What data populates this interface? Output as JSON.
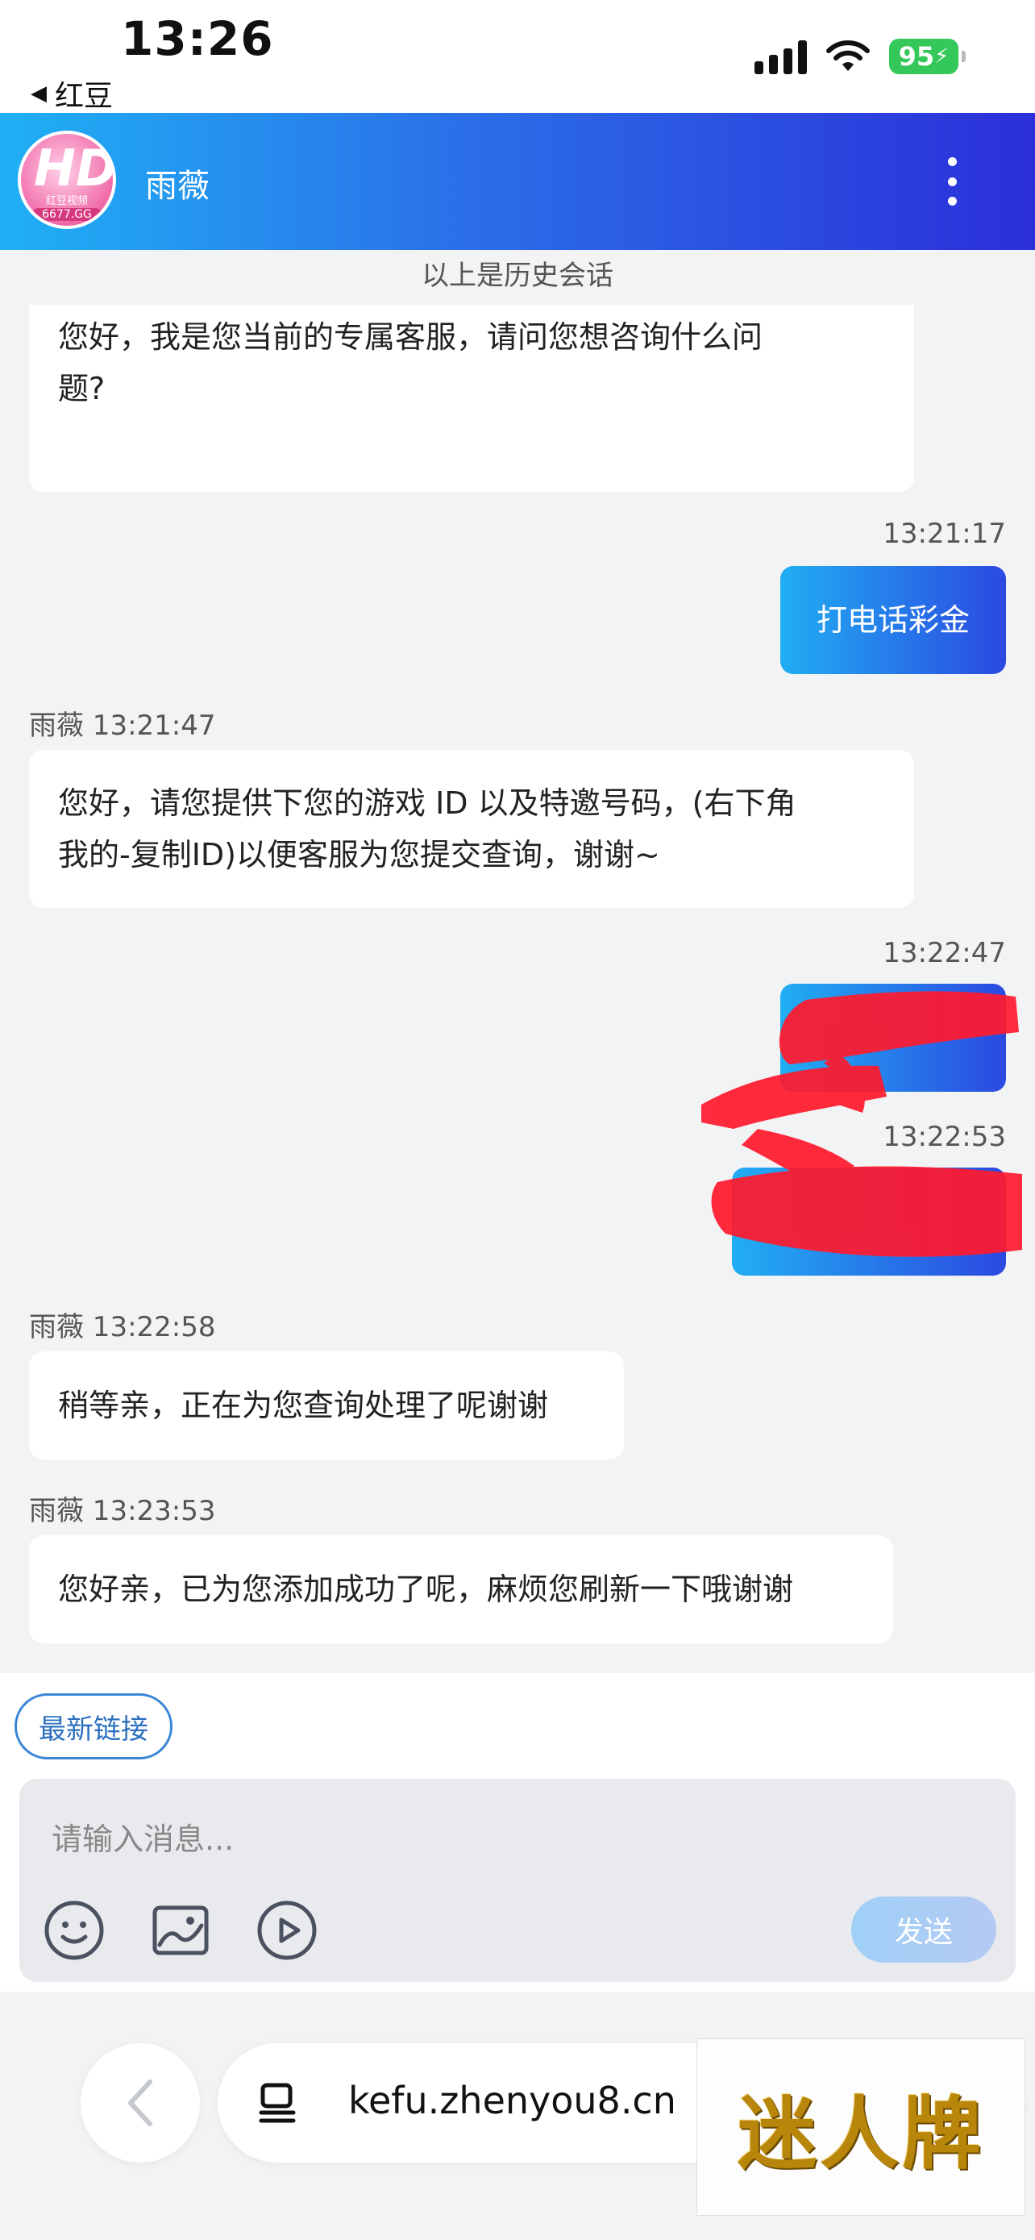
{
  "status_bar": {
    "time": "13:26",
    "back_app": "红豆",
    "battery": "95"
  },
  "header": {
    "title": "雨薇",
    "avatar_text": "HD",
    "avatar_caption": "红豆视频",
    "avatar_domain": "6677.GG"
  },
  "chat": {
    "history_note": "以上是历史会话",
    "messages": [
      {
        "side": "agent",
        "meta": "",
        "text_line1": "您好，我是您当前的专属客服，请问您想咨询什么问",
        "text_line2": "题?"
      },
      {
        "side": "user",
        "meta": "13:21:17",
        "text": "打电话彩金"
      },
      {
        "side": "agent",
        "meta": "雨薇 13:21:47",
        "text_line1": "您好，请您提供下您的游戏 ID 以及特邀号码，(右下角",
        "text_line2": "我的-复制ID)以便客服为您提交查询，谢谢~"
      },
      {
        "side": "user",
        "meta": "13:22:47",
        "text": ""
      },
      {
        "side": "user",
        "meta": "13:22:53",
        "text": ""
      },
      {
        "side": "agent",
        "meta": "雨薇 13:22:58",
        "text": "稍等亲，正在为您查询处理了呢谢谢"
      },
      {
        "side": "agent",
        "meta": "雨薇 13:23:53",
        "text": "您好亲，已为您添加成功了呢，麻烦您刷新一下哦谢谢"
      }
    ]
  },
  "latest_link": "最新链接",
  "composer": {
    "placeholder": "请输入消息...",
    "send_label": "发送",
    "tools": [
      "emoji-icon",
      "image-icon",
      "video-icon"
    ]
  },
  "browser": {
    "url": "kefu.zhenyou8.cn"
  },
  "watermark": "迷人牌",
  "colors": {
    "header_gradient_start": "#1fb0f5",
    "header_gradient_end": "#2b2fd9",
    "user_bubble_start": "#21aef3",
    "user_bubble_end": "#2b49e1",
    "redaction": "#ff1a2e"
  }
}
